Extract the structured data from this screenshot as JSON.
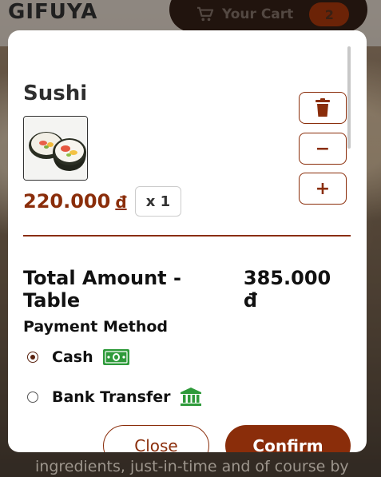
{
  "background": {
    "brand": "GIFUYA",
    "cart": {
      "label": "Your Cart",
      "count": "2"
    },
    "text": "ingredients, just-in-time and of course by"
  },
  "modal": {
    "item": {
      "name": "Sushi",
      "price": "220.000",
      "currency": "đ",
      "quantity": "x 1",
      "image_icon": "sushi-roll-icon"
    },
    "controls": {
      "delete_icon": "trash-icon",
      "decrease_label": "−",
      "increase_label": "+"
    },
    "total": {
      "label": "Total Amount - Table",
      "value": "385.000 đ"
    },
    "payment": {
      "title": "Payment Method",
      "options": [
        {
          "label": "Cash",
          "icon": "cash-icon",
          "selected": true
        },
        {
          "label": "Bank Transfer",
          "icon": "bank-icon",
          "selected": false
        }
      ]
    },
    "buttons": {
      "close": "Close",
      "confirm": "Confirm"
    }
  },
  "colors": {
    "accent": "#8a2d0a",
    "cart_bg": "#2b1a12",
    "icon_green": "#2e9a3a"
  }
}
